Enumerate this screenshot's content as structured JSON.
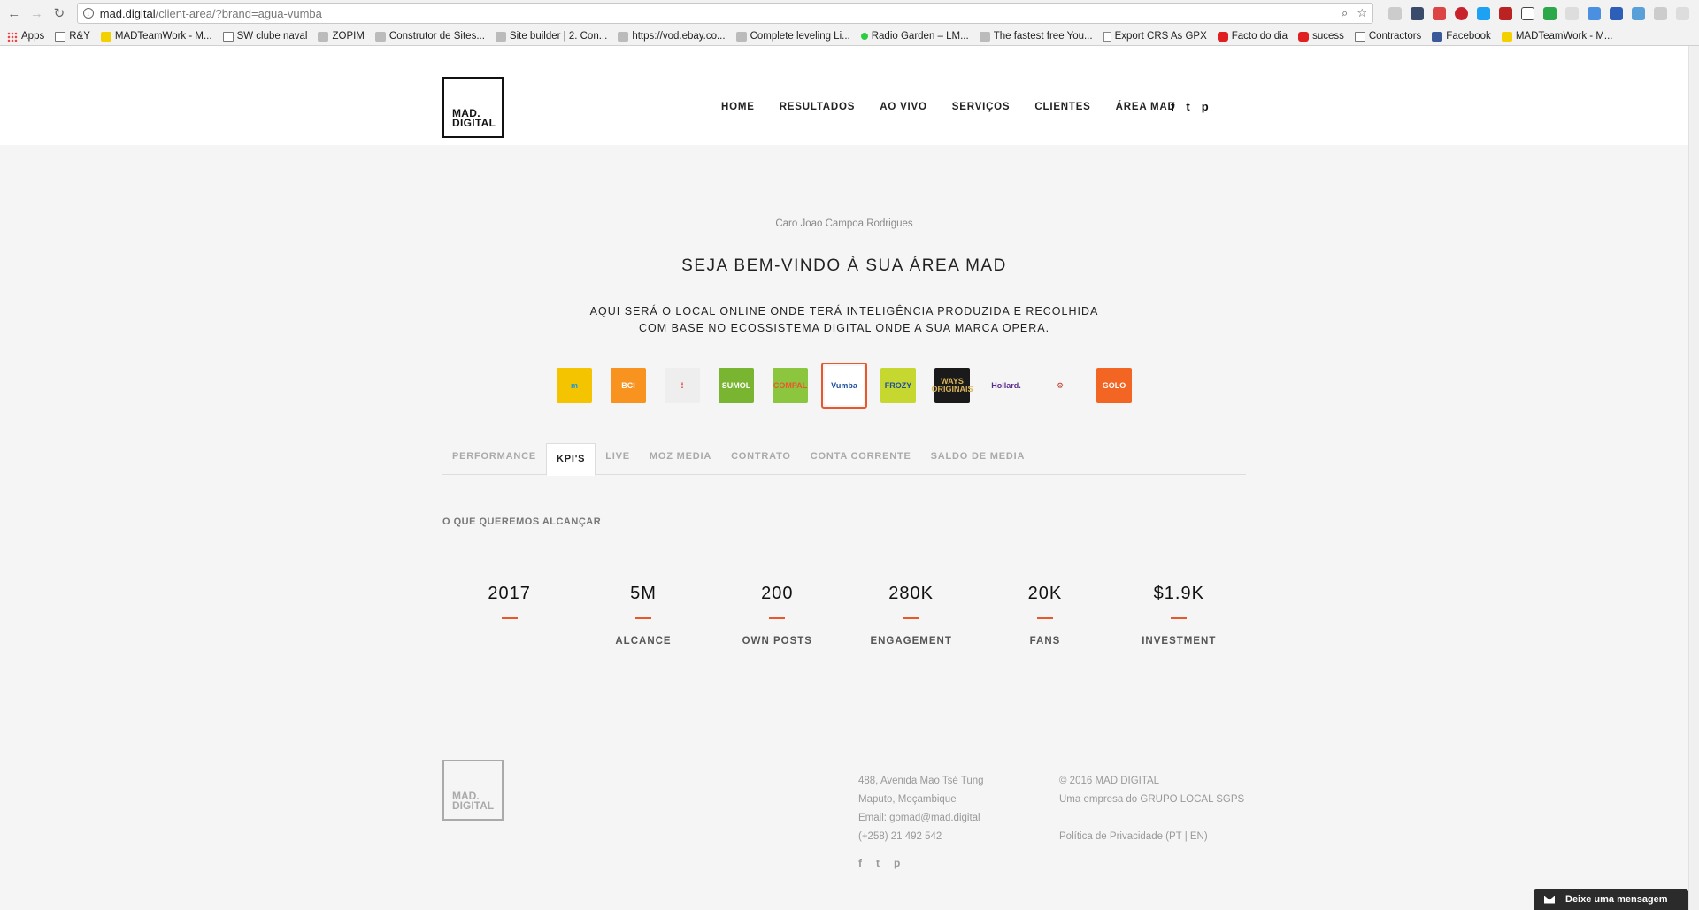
{
  "browser": {
    "url_host": "mad.digital",
    "url_path": "/client-area/?brand=agua-vumba",
    "bookmarks": [
      {
        "label": "Apps",
        "icon": "apps-grid-icon"
      },
      {
        "label": "R&Y",
        "icon": "folder-icon"
      },
      {
        "label": "MADTeamWork - M...",
        "icon": "madteamwork-icon"
      },
      {
        "label": "SW clube naval",
        "icon": "folder-icon"
      },
      {
        "label": "ZOPIM",
        "icon": "zopim-icon"
      },
      {
        "label": "Construtor de Sites...",
        "icon": "site-builder-icon"
      },
      {
        "label": "Site builder | 2. Con...",
        "icon": "checkmark-icon"
      },
      {
        "label": "https://vod.ebay.co...",
        "icon": "ebay-icon"
      },
      {
        "label": "Complete leveling Li...",
        "icon": "tv-icon"
      },
      {
        "label": "Radio Garden – LM...",
        "icon": "green-dot-icon"
      },
      {
        "label": "The fastest free You...",
        "icon": "download-icon"
      },
      {
        "label": "Export CRS As GPX",
        "icon": "page-icon"
      },
      {
        "label": "Facto do dia",
        "icon": "youtube-icon"
      },
      {
        "label": "sucess",
        "icon": "youtube-icon"
      },
      {
        "label": "Contractors",
        "icon": "folder-icon"
      },
      {
        "label": "Facebook",
        "icon": "facebook-icon"
      },
      {
        "label": "MADTeamWork - M...",
        "icon": "madteamwork-icon"
      }
    ]
  },
  "site": {
    "logo_line1": "MAD.",
    "logo_line2": "DIGITAL",
    "nav": [
      "HOME",
      "RESULTADOS",
      "AO VIVO",
      "SERVIÇOS",
      "CLIENTES",
      "ÁREA MAD"
    ],
    "social": [
      "f",
      "t",
      "p"
    ]
  },
  "main": {
    "greeting": "Caro Joao Campoa Rodrigues",
    "title": "SEJA BEM-VINDO À SUA ÁREA MAD",
    "subtitle": "AQUI SERÁ O LOCAL ONLINE ONDE TERÁ INTELIGÊNCIA PRODUZIDA E RECOLHIDA COM BASE NO ECOSSISTEMA DIGITAL ONDE A SUA MARCA OPERA.",
    "brands": [
      {
        "name": "brand-m",
        "text": "m",
        "bg": "#f5c400",
        "fg": "#1a9bd7"
      },
      {
        "name": "brand-bci",
        "text": "BCI",
        "bg": "#f7931e",
        "fg": "#ffffff"
      },
      {
        "name": "brand-clock",
        "text": "⁞",
        "bg": "#eeeeee",
        "fg": "#e02020"
      },
      {
        "name": "brand-sumol",
        "text": "SUMOL",
        "bg": "#79b530",
        "fg": "#ffffff"
      },
      {
        "name": "brand-compal",
        "text": "COMPAL",
        "bg": "#8cc63f",
        "fg": "#e8582c"
      },
      {
        "name": "brand-vumba",
        "text": "Vumba",
        "bg": "#ffffff",
        "fg": "#1d4f9c",
        "active": true
      },
      {
        "name": "brand-frozy",
        "text": "FROZY",
        "bg": "#c6d82f",
        "fg": "#1d4f9c"
      },
      {
        "name": "brand-ways",
        "text": "WAYS ORIGINAIS",
        "bg": "#1a1a1a",
        "fg": "#d8b45a"
      },
      {
        "name": "brand-hollard",
        "text": "Hollard.",
        "bg": "#f5f5f5",
        "fg": "#5b2d8e"
      },
      {
        "name": "brand-emblem",
        "text": "⚙",
        "bg": "#f5f5f5",
        "fg": "#c0392b"
      },
      {
        "name": "brand-golo",
        "text": "GOLO",
        "bg": "#f26522",
        "fg": "#ffffff"
      }
    ],
    "tabs": [
      {
        "label": "PERFORMANCE",
        "active": false
      },
      {
        "label": "KPI'S",
        "active": true
      },
      {
        "label": "LIVE",
        "active": false
      },
      {
        "label": "MOZ MEDIA",
        "active": false
      },
      {
        "label": "CONTRATO",
        "active": false
      },
      {
        "label": "CONTA CORRENTE",
        "active": false
      },
      {
        "label": "SALDO DE MEDIA",
        "active": false
      }
    ],
    "section_label": "O QUE QUEREMOS ALCANÇAR",
    "kpis": [
      {
        "value": "2017",
        "label": ""
      },
      {
        "value": "5M",
        "label": "ALCANCE"
      },
      {
        "value": "200",
        "label": "OWN POSTS"
      },
      {
        "value": "280K",
        "label": "ENGAGEMENT"
      },
      {
        "value": "20K",
        "label": "FANS"
      },
      {
        "value": "$1.9K",
        "label": "INVESTMENT"
      }
    ],
    "accent_color": "#e8582c"
  },
  "footer": {
    "address": [
      "488, Avenida Mao Tsé Tung",
      "Maputo, Moçambique",
      "Email: gomad@mad.digital",
      "(+258) 21 492 542"
    ],
    "company": [
      "© 2016 MAD DIGITAL",
      "Uma empresa do GRUPO LOCAL SGPS"
    ],
    "privacy": "Política de Privacidade (PT | EN)",
    "social": [
      "f",
      "t",
      "p"
    ]
  },
  "chat": {
    "label": "Deixe uma mensagem"
  }
}
